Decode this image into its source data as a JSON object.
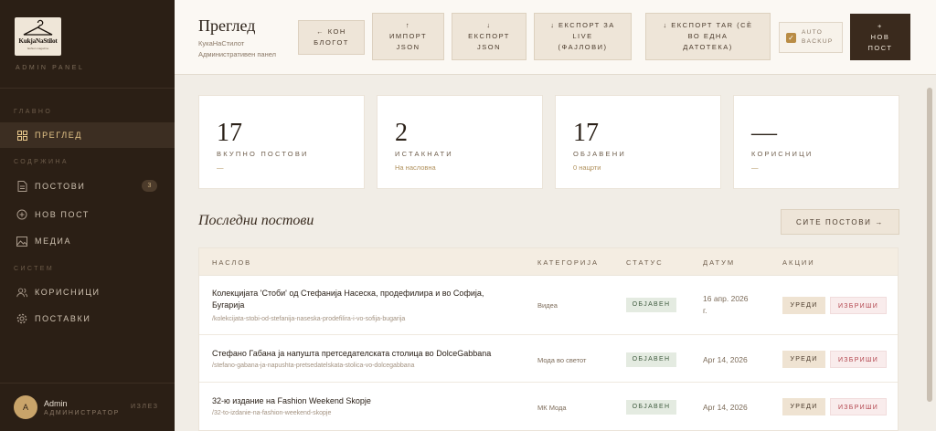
{
  "sidebar": {
    "logo_text": "KukjaNaStilot",
    "logo_sub": "fashion magazine",
    "subtitle": "ADMIN PANEL",
    "sections": {
      "main": "ГЛАВНО",
      "content": "СОДРЖИНА",
      "system": "СИСТЕМ"
    },
    "items": [
      {
        "label": "ПРЕГЛЕД"
      },
      {
        "label": "ПОСТОВИ",
        "badge": "3"
      },
      {
        "label": "НОВ ПОСТ"
      },
      {
        "label": "МЕДИА"
      },
      {
        "label": "КОРИСНИЦИ"
      },
      {
        "label": "ПОСТАВКИ"
      }
    ],
    "user": {
      "initial": "A",
      "name": "Admin",
      "role": "АДМИНИСТРАТОР",
      "logout": "ИЗЛЕЗ"
    }
  },
  "header": {
    "title": "Преглед",
    "crumb1": "КукаНаСтилот",
    "crumb2": "Административен панел",
    "buttons": {
      "to_blog_1": "← КОН",
      "to_blog_2": "БЛОГОТ",
      "import_1": "↑",
      "import_2": "ИМПОРТ",
      "import_3": "JSON",
      "export_1": "↓",
      "export_2": "ЕКСПОРТ",
      "export_3": "JSON",
      "live_1": "↓ ЕКСПОРТ ЗА",
      "live_2": "LIVE",
      "live_3": "(ФАЈЛОВИ)",
      "tar_1": "↓ ЕКСПОРТ TAR (СÈ",
      "tar_2": "ВО ЕДНА",
      "tar_3": "ДАТОТЕКА)",
      "auto_1": "AUTO",
      "auto_2": "BACKUP",
      "new_1": "+",
      "new_2": "НОВ",
      "new_3": "ПОСТ"
    },
    "auto_backup_checked": true
  },
  "stats": [
    {
      "num": "17",
      "label": "ВКУПНО ПОСТОВИ",
      "sub": "—"
    },
    {
      "num": "2",
      "label": "ИСТАКНАТИ",
      "sub": "На насловна"
    },
    {
      "num": "17",
      "label": "ОБЈАВЕНИ",
      "sub": "0 нацрти"
    },
    {
      "num": "—",
      "label": "КОРИСНИЦИ",
      "sub": "—"
    }
  ],
  "recent": {
    "title": "Последни постови",
    "all_label": "СИТЕ ПОСТОВИ →",
    "columns": [
      "НАСЛОВ",
      "КАТЕГОРИЈА",
      "СТАТУС",
      "ДАТУМ",
      "АКЦИИ"
    ],
    "edit_label": "УРЕДИ",
    "delete_label": "ИЗБРИШИ",
    "rows": [
      {
        "title_1": "Колекцијата 'Стоби' од Стефанија Насеска, продефилира и во Софија,",
        "title_2": "Бугарија",
        "slug": "/kolekcijata-stobi-od-stefanija-naseska-prodefilira-i-vo-sofija-bugarija",
        "category": "Видеа",
        "status": "ОБЈАВЕН",
        "date_1": "16 апр. 2026",
        "date_2": "г."
      },
      {
        "title_1": "Стефано Габана ја напушта претседателската столица во DolceGabbana",
        "slug": "/stefano-gabana-ja-napushta-pretsedatelskata-stolica-vo-dolcegabbana",
        "category": "Мода во светот",
        "status": "ОБЈАВЕН",
        "date_1": "Apr 14, 2026"
      },
      {
        "title_1": "32-ю издание на Fashion Weekend Skopje",
        "slug": "/32-to-izdanie-na-fashion-weekend-skopje",
        "category": "МК Мода",
        "status": "ОБЈАВЕН",
        "date_1": "Apr 14, 2026"
      }
    ]
  }
}
